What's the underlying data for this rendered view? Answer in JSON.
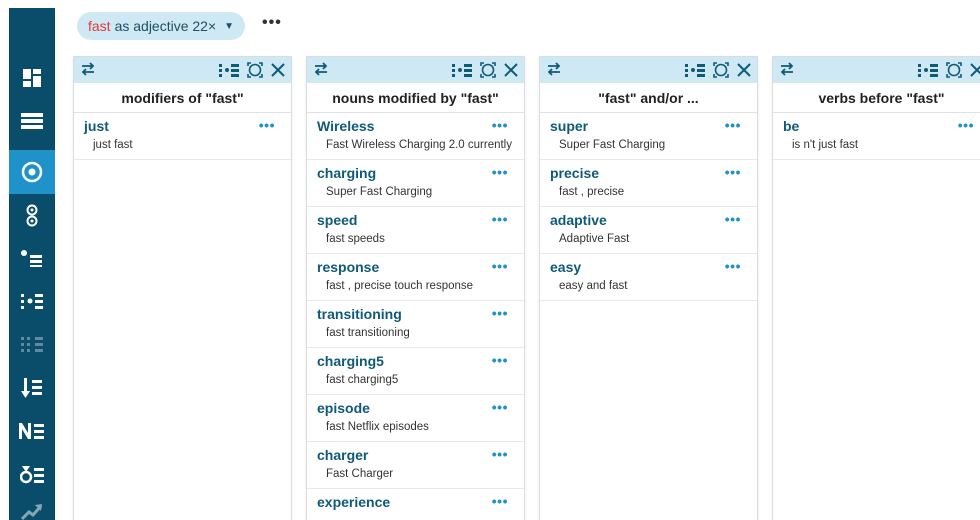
{
  "query": {
    "keyword": "fast",
    "rest": "as adjective 22×",
    "caret": "▼",
    "more": "•••"
  },
  "sidebar": {
    "icons": [
      "dashboard-icon",
      "list-icon",
      "target-icon",
      "two-circles-icon",
      "bullet-list-icon",
      "grid-list-icon",
      "grid-list-faded-icon",
      "sort-list-icon",
      "ne-list-icon",
      "delta-list-icon",
      "trend-icon"
    ],
    "active_index": 2
  },
  "panels": [
    {
      "title": "modifiers of \"fast\"",
      "entries": [
        {
          "word": "just",
          "example": "just fast"
        }
      ]
    },
    {
      "title": "nouns modified by \"fast\"",
      "entries": [
        {
          "word": "Wireless",
          "example": "Fast Wireless Charging 2.0 currently"
        },
        {
          "word": "charging",
          "example": "Super Fast Charging"
        },
        {
          "word": "speed",
          "example": "fast speeds"
        },
        {
          "word": "response",
          "example": "fast , precise touch response"
        },
        {
          "word": "transitioning",
          "example": "fast transitioning"
        },
        {
          "word": "charging5",
          "example": "fast charging5"
        },
        {
          "word": "episode",
          "example": "fast Netflix episodes"
        },
        {
          "word": "charger",
          "example": "Fast Charger"
        },
        {
          "word": "experience",
          "example": ""
        }
      ]
    },
    {
      "title": "\"fast\" and/or ...",
      "entries": [
        {
          "word": "super",
          "example": "Super Fast Charging"
        },
        {
          "word": "precise",
          "example": "fast , precise"
        },
        {
          "word": "adaptive",
          "example": "Adaptive Fast"
        },
        {
          "word": "easy",
          "example": "easy and fast"
        }
      ]
    },
    {
      "title": "verbs before \"fast\"",
      "entries": [
        {
          "word": "be",
          "example": "is n't just fast"
        }
      ]
    }
  ],
  "entry_more": "•••",
  "colors": {
    "sidebar": "#0a4d6b",
    "sidebar_active": "#1f93c9",
    "pill": "#cfe9f4",
    "keyword": "#e53935",
    "word": "#0f5a78"
  }
}
